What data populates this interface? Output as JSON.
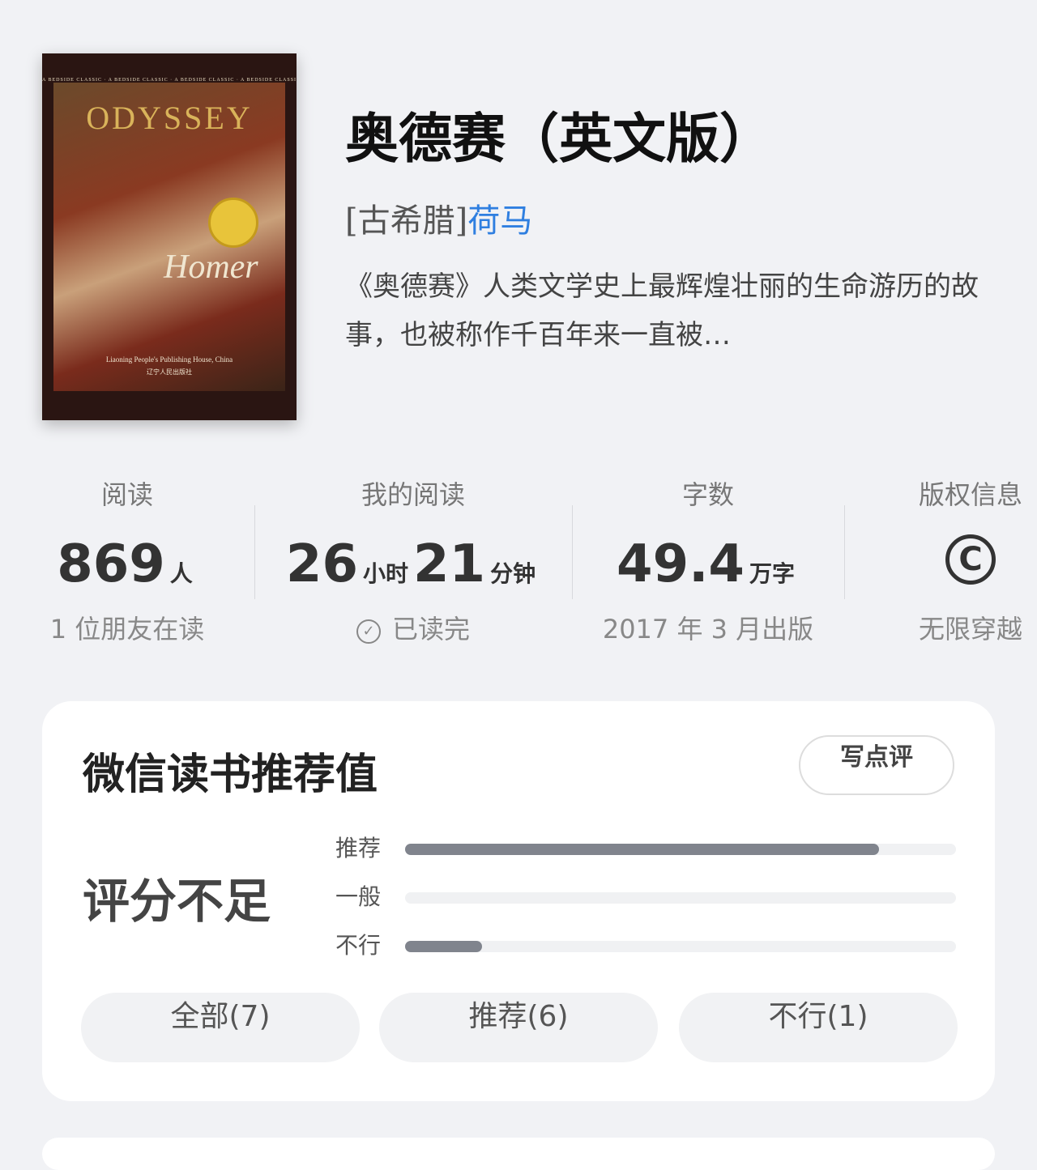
{
  "book": {
    "title": "奥德赛（英文版）",
    "author_prefix": "[古希腊]",
    "author_name": "荷马",
    "description": "《奥德赛》人类文学史上最辉煌壮丽的生命游历的故事，也被称作千百年来一直被…",
    "cover": {
      "strip": "A BEDSIDE CLASSIC · A BEDSIDE CLASSIC · A BEDSIDE CLASSIC · A BEDSIDE CLASSIC",
      "title": "ODYSSEY",
      "author": "Homer",
      "publisher": "Liaoning People's Publishing House, China",
      "publisher_cn": "辽宁人民出版社"
    }
  },
  "stats": {
    "readers": {
      "label": "阅读",
      "value": "869",
      "unit": "人",
      "sub": "1 位朋友在读"
    },
    "my_reading": {
      "label": "我的阅读",
      "hours": "26",
      "hours_unit": "小时",
      "minutes": "21",
      "minutes_unit": "分钟",
      "sub": "已读完",
      "sub_icon": "check-circle-icon"
    },
    "word_count": {
      "label": "字数",
      "value": "49.4",
      "unit": "万字",
      "sub": "2017 年 3 月出版"
    },
    "copyright": {
      "label": "版权信息",
      "icon": "copyright-icon",
      "sub": "无限穿越"
    }
  },
  "rating": {
    "title": "微信读书推荐值",
    "write_review": "写点评",
    "score_text": "评分不足",
    "bars": [
      {
        "label": "推荐",
        "fraction": 0.86
      },
      {
        "label": "一般",
        "fraction": 0.0
      },
      {
        "label": "不行",
        "fraction": 0.14
      }
    ],
    "filters": [
      {
        "label": "全部(7)"
      },
      {
        "label": "推荐(6)"
      },
      {
        "label": "不行(1)"
      }
    ]
  },
  "colors": {
    "link": "#2f7fe0",
    "bar_fill": "#80848d",
    "bar_track": "#f0f1f3",
    "background": "#f1f2f5"
  }
}
